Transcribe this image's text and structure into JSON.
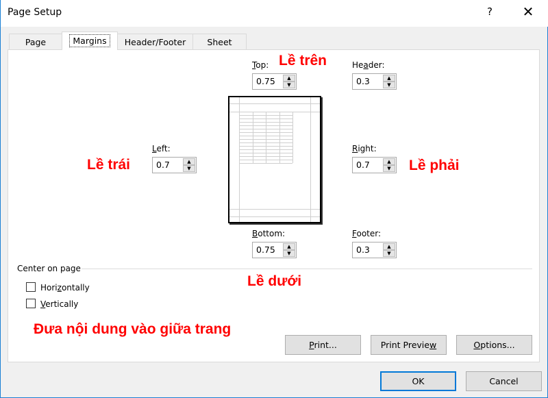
{
  "window": {
    "title": "Page Setup",
    "help": "?",
    "close": "✕"
  },
  "tabs": [
    {
      "label": "Page"
    },
    {
      "label": "Margins"
    },
    {
      "label": "Header/Footer"
    },
    {
      "label": "Sheet"
    }
  ],
  "margins": {
    "top": {
      "pre": "",
      "key": "T",
      "post": "op:",
      "value": "0.75"
    },
    "header": {
      "pre": "He",
      "key": "a",
      "post": "der:",
      "value": "0.3"
    },
    "left": {
      "pre": "",
      "key": "L",
      "post": "eft:",
      "value": "0.7"
    },
    "right": {
      "pre": "",
      "key": "R",
      "post": "ight:",
      "value": "0.7"
    },
    "bottom": {
      "pre": "",
      "key": "B",
      "post": "ottom:",
      "value": "0.75"
    },
    "footer": {
      "pre": "",
      "key": "F",
      "post": "ooter:",
      "value": "0.3"
    }
  },
  "center": {
    "label": "Center on page",
    "horizontally": {
      "pre": "Hori",
      "key": "z",
      "post": "ontally",
      "checked": false
    },
    "vertically": {
      "pre": "",
      "key": "V",
      "post": "ertically",
      "checked": false
    }
  },
  "buttons": {
    "print": {
      "pre": "",
      "key": "P",
      "post": "rint..."
    },
    "preview": {
      "pre": "Print Previe",
      "key": "w",
      "post": ""
    },
    "options": {
      "pre": "",
      "key": "O",
      "post": "ptions..."
    },
    "ok": "OK",
    "cancel": "Cancel"
  },
  "annotations": {
    "top": "Lề trên",
    "left": "Lề trái",
    "right": "Lề phải",
    "bottom": "Lề dưới",
    "center": "Đưa nội dung vào giữa trang"
  },
  "colors": {
    "annotation": "#ff0000",
    "accent": "#0078d7"
  }
}
